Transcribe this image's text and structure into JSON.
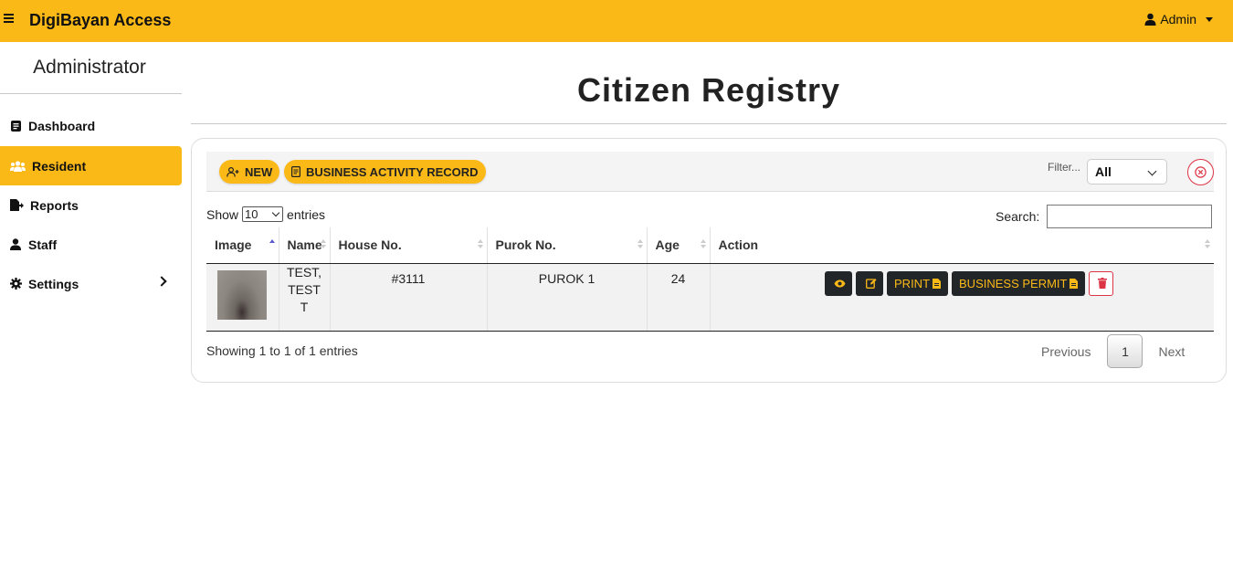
{
  "app": {
    "brand": "DigiBayan Access",
    "user": "Admin"
  },
  "sidebar": {
    "title": "Administrator",
    "items": [
      {
        "label": "Dashboard",
        "icon": "dashboard-icon",
        "active": false
      },
      {
        "label": "Resident",
        "icon": "users-icon",
        "active": true
      },
      {
        "label": "Reports",
        "icon": "report-icon",
        "active": false
      },
      {
        "label": "Staff",
        "icon": "user-icon",
        "active": false
      },
      {
        "label": "Settings",
        "icon": "gear-icon",
        "active": false
      }
    ]
  },
  "page": {
    "title": "Citizen Registry"
  },
  "toolbar": {
    "new_label": "NEW",
    "business_label": "BUSINESS ACTIVITY RECORD",
    "filter_label": "Filter...",
    "filter_value": "All"
  },
  "table_controls": {
    "show_label": "Show",
    "entries_value": "10",
    "entries_label": "entries",
    "search_label": "Search:"
  },
  "table": {
    "columns": [
      "Image",
      "Name",
      "House No.",
      "Purok No.",
      "Age",
      "Action"
    ],
    "rows": [
      {
        "name_line1": "TEST,",
        "name_line2": "TEST",
        "name_line3": "T",
        "house_no": "#3111",
        "purok_no": "PUROK 1",
        "age": "24"
      }
    ],
    "actions": {
      "print_label": "PRINT",
      "permit_label": "BUSINESS PERMIT"
    }
  },
  "footer": {
    "info": "Showing 1 to 1 of 1 entries",
    "previous": "Previous",
    "page": "1",
    "next": "Next"
  },
  "colors": {
    "accent": "#fbb917",
    "dark": "#222629",
    "danger": "#dc3545"
  }
}
